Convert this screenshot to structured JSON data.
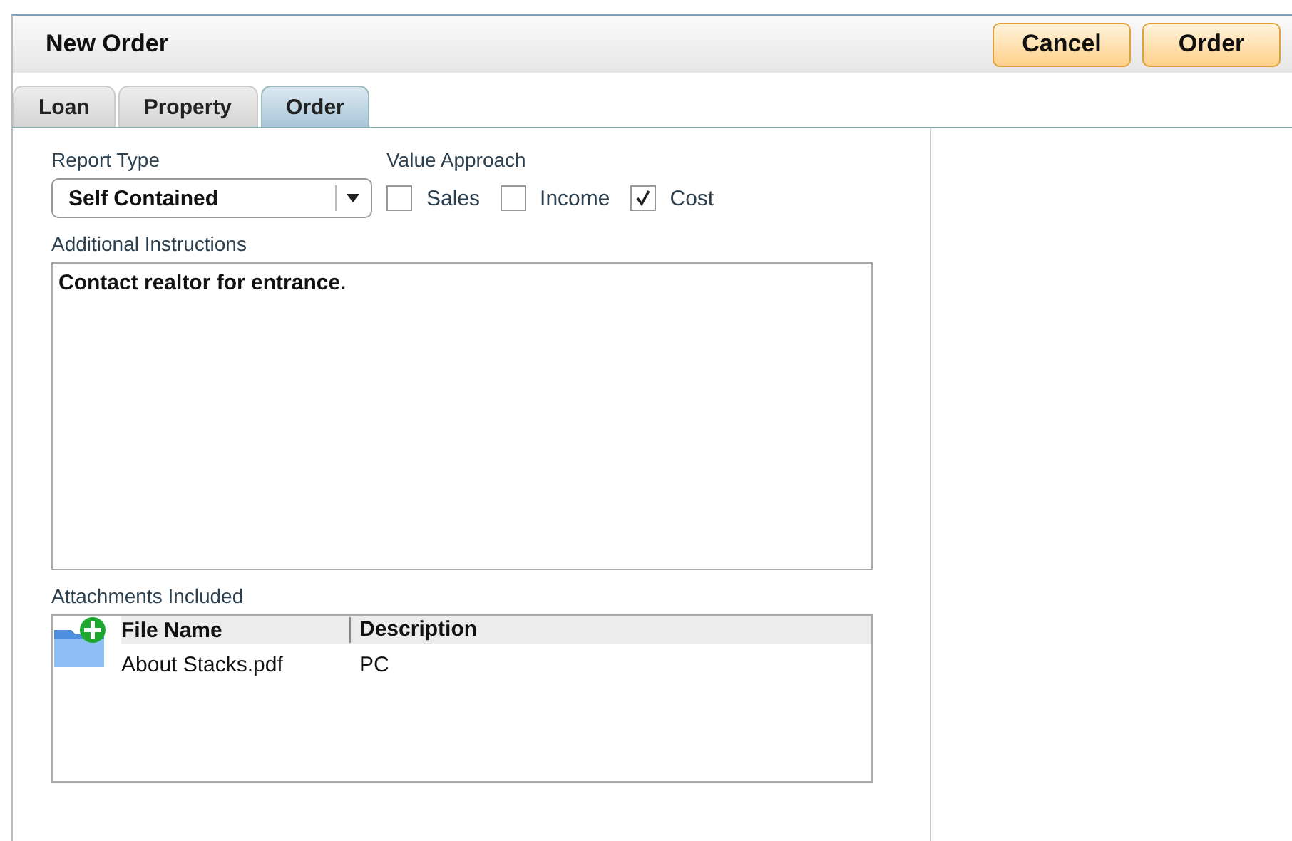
{
  "window": {
    "title": "New Order"
  },
  "buttons": [
    "Cancel",
    "Order"
  ],
  "tabs": [
    {
      "label": "Loan",
      "selected": false
    },
    {
      "label": "Property",
      "selected": false
    },
    {
      "label": "Order",
      "selected": true
    }
  ],
  "report_type": {
    "label": "Report Type",
    "value": "Self Contained"
  },
  "value_approach": {
    "label": "Value Approach",
    "options": [
      {
        "label": "Sales",
        "checked": false
      },
      {
        "label": "Income",
        "checked": false
      },
      {
        "label": "Cost",
        "checked": true
      }
    ]
  },
  "instructions": {
    "label": "Additional Instructions",
    "value": "Contact realtor for entrance."
  },
  "attachments": {
    "label": "Attachments Included",
    "columns": [
      "File Name",
      "Description"
    ],
    "rows": [
      [
        "About Stacks.pdf",
        "PC"
      ]
    ]
  }
}
